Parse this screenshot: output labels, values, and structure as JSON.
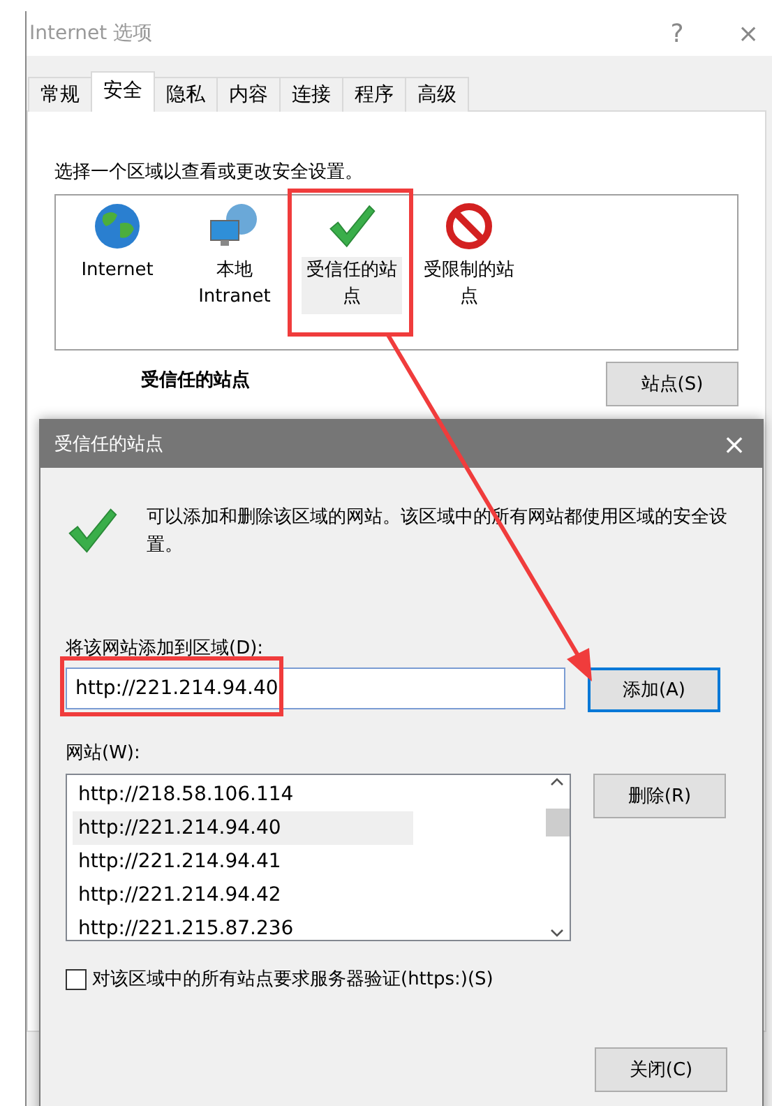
{
  "window": {
    "title": "Internet 选项",
    "help": "?",
    "close": "×"
  },
  "tabs": [
    {
      "label": "常规",
      "selected": false
    },
    {
      "label": "安全",
      "selected": true
    },
    {
      "label": "隐私",
      "selected": false
    },
    {
      "label": "内容",
      "selected": false
    },
    {
      "label": "连接",
      "selected": false
    },
    {
      "label": "程序",
      "selected": false
    },
    {
      "label": "高级",
      "selected": false
    }
  ],
  "zone_prompt": "选择一个区域以查看或更改安全设置。",
  "zones": [
    {
      "label": "Internet",
      "kind": "globe",
      "selected": false
    },
    {
      "label": "本地 Intranet",
      "kind": "network",
      "selected": false
    },
    {
      "label": "受信任的站点",
      "kind": "check",
      "selected": true
    },
    {
      "label": "受限制的站点",
      "kind": "prohibit",
      "selected": false
    }
  ],
  "zone_detail": {
    "title": "受信任的站点",
    "button": "站点(S)"
  },
  "dialog": {
    "title": "受信任的站点",
    "close": "×",
    "message": "可以添加和删除该区域的网站。该区域中的所有网站都使用区域的安全设置。",
    "add_label": "将该网站添加到区域(D):",
    "add_value": "http://221.214.94.40",
    "add_button": "添加(A)",
    "sites_label": "网站(W):",
    "sites": [
      {
        "url": "http://218.58.106.114",
        "selected": false
      },
      {
        "url": "http://221.214.94.40",
        "selected": true
      },
      {
        "url": "http://221.214.94.41",
        "selected": false
      },
      {
        "url": "http://221.214.94.42",
        "selected": false
      },
      {
        "url": "http://221.215.87.236",
        "selected": false
      }
    ],
    "remove_button": "删除(R)",
    "https_required": {
      "label": "对该区域中的所有站点要求服务器验证(https:)(S)",
      "checked": false
    },
    "close_button": "关闭(C)"
  }
}
